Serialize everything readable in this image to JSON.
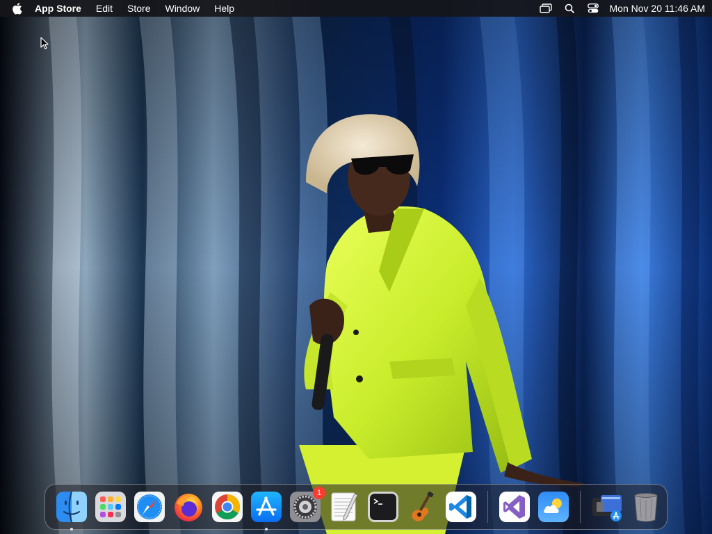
{
  "menubar": {
    "app_name": "App Store",
    "menus": [
      "Edit",
      "Store",
      "Window",
      "Help"
    ],
    "status_icons": [
      "screen-mirroring-icon",
      "spotlight-search-icon",
      "control-center-icon"
    ],
    "clock": "Mon Nov 20  11:46 AM"
  },
  "dock": {
    "apps": [
      {
        "name": "Finder",
        "icon": "finder-icon",
        "running": true
      },
      {
        "name": "Launchpad",
        "icon": "launchpad-icon",
        "running": false
      },
      {
        "name": "Safari",
        "icon": "safari-icon",
        "running": false
      },
      {
        "name": "Firefox",
        "icon": "firefox-icon",
        "running": false
      },
      {
        "name": "Google Chrome",
        "icon": "chrome-icon",
        "running": false
      },
      {
        "name": "App Store",
        "icon": "app-store-icon",
        "running": true
      },
      {
        "name": "System Settings",
        "icon": "system-settings-icon",
        "running": false,
        "badge": "1"
      },
      {
        "name": "TextEdit",
        "icon": "textedit-icon",
        "running": false
      },
      {
        "name": "Terminal",
        "icon": "terminal-icon",
        "running": false
      },
      {
        "name": "GarageBand",
        "icon": "garageband-icon",
        "running": false
      },
      {
        "name": "Visual Studio Code",
        "icon": "vscode-icon",
        "running": false
      }
    ],
    "recent": [
      {
        "name": "Visual Studio",
        "icon": "visual-studio-icon"
      },
      {
        "name": "Weather",
        "icon": "weather-icon"
      }
    ],
    "stack": {
      "name": "Downloads",
      "icon": "downloads-stack-icon"
    },
    "trash": {
      "name": "Trash",
      "icon": "trash-icon"
    }
  }
}
